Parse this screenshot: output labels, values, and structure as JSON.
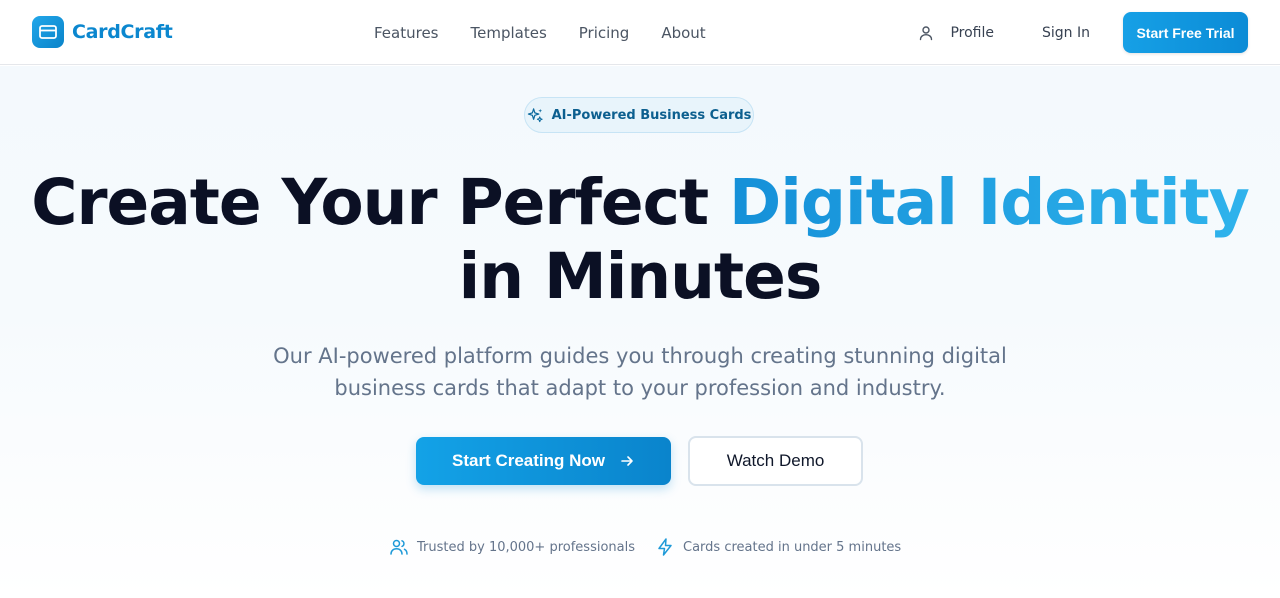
{
  "brand": {
    "name": "CardCraft",
    "accent": "#0b87cf"
  },
  "nav": {
    "links": [
      "Features",
      "Templates",
      "Pricing",
      "About"
    ],
    "profile_label": "Profile",
    "signin_label": "Sign In",
    "trial_label": "Start Free Trial"
  },
  "hero": {
    "badge_label": "AI-Powered Business Cards",
    "headline_part1": "Create Your Perfect ",
    "headline_highlight": "Digital Identity",
    "headline_part2": " in Minutes",
    "subtitle": "Our AI-powered platform guides you through creating stunning digital business cards that adapt to your profession and industry.",
    "primary_cta": "Start Creating Now",
    "secondary_cta": "Watch Demo",
    "trust_items": [
      {
        "icon": "users-icon",
        "text": "Trusted by 10,000+ professionals"
      },
      {
        "icon": "lightning-icon",
        "text": "Cards created in under 5 minutes"
      }
    ]
  }
}
